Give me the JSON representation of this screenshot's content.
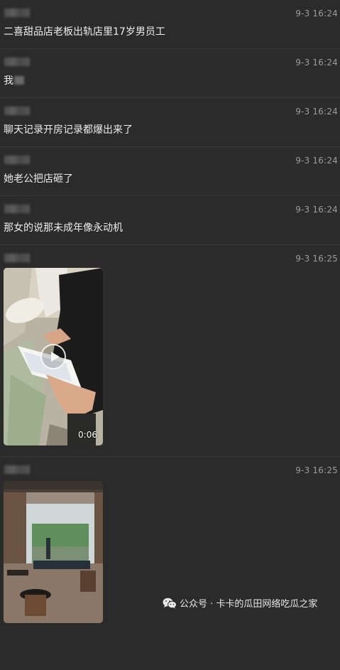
{
  "messages": [
    {
      "time": "9-3 16:24",
      "text": "二喜甜品店老板出轨店里17岁男员工"
    },
    {
      "time": "9-3 16:24",
      "text": "我"
    },
    {
      "time": "9-3 16:24",
      "text": "聊天记录开房记录都爆出来了"
    },
    {
      "time": "9-3 16:24",
      "text": "她老公把店砸了"
    },
    {
      "time": "9-3 16:24",
      "text": "那女的说那未成年像永动机"
    },
    {
      "time": "9-3 16:25",
      "video_duration": "0:06"
    },
    {
      "time": "9-3 16:25"
    }
  ],
  "watermark": {
    "text": "公众号 · 卡卡的瓜田网络吃瓜之家",
    "icon": "wechat-icon"
  },
  "colors": {
    "background": "#2b2b2b",
    "text": "#ececec",
    "time": "#9c9c9c"
  }
}
